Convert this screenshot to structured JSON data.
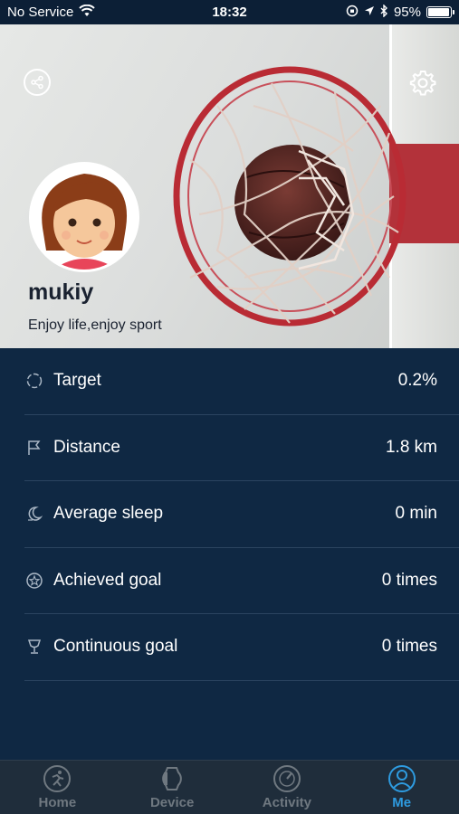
{
  "status_bar": {
    "carrier": "No Service",
    "time": "18:32",
    "battery": "95%",
    "battery_level": 0.95
  },
  "profile": {
    "username": "mukiy",
    "bio": "Enjoy life,enjoy sport"
  },
  "stats": [
    {
      "icon": "target-icon",
      "label": "Target",
      "value": "0.2%"
    },
    {
      "icon": "flag-icon",
      "label": "Distance",
      "value": "1.8 km"
    },
    {
      "icon": "moon-icon",
      "label": "Average sleep",
      "value": "0 min"
    },
    {
      "icon": "star-icon",
      "label": "Achieved goal",
      "value": "0 times"
    },
    {
      "icon": "trophy-icon",
      "label": "Continuous goal",
      "value": "0 times"
    }
  ],
  "tabs": [
    {
      "label": "Home",
      "icon": "run-icon",
      "active": false
    },
    {
      "label": "Device",
      "icon": "watch-icon",
      "active": false
    },
    {
      "label": "Activity",
      "icon": "gauge-icon",
      "active": false
    },
    {
      "label": "Me",
      "icon": "person-icon",
      "active": true
    }
  ],
  "colors": {
    "accent": "#2e9be0",
    "background": "#0f2843",
    "tab_inactive": "#6f7880"
  }
}
